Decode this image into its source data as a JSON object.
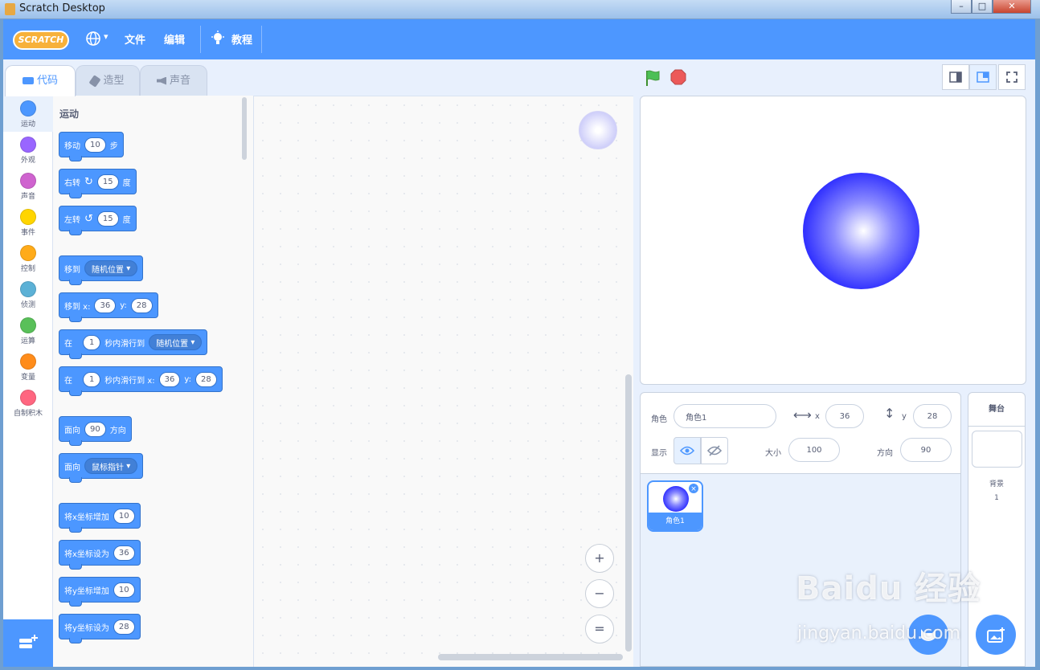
{
  "window": {
    "title": "Scratch Desktop",
    "controls": [
      "–",
      "□",
      "✕"
    ]
  },
  "menubar": {
    "logo": "SCRATCH",
    "language_caret": "▾",
    "file": "文件",
    "edit": "编辑",
    "tutorials": "教程"
  },
  "tabs": [
    "代码",
    "造型",
    "声音"
  ],
  "categories": [
    {
      "label": "运动",
      "color": "#4c97ff"
    },
    {
      "label": "外观",
      "color": "#9966ff"
    },
    {
      "label": "声音",
      "color": "#cf63cf"
    },
    {
      "label": "事件",
      "color": "#ffd500"
    },
    {
      "label": "控制",
      "color": "#ffab19"
    },
    {
      "label": "侦测",
      "color": "#5cb1d6"
    },
    {
      "label": "运算",
      "color": "#59c059"
    },
    {
      "label": "变量",
      "color": "#ff8c1a"
    },
    {
      "label": "自制积木",
      "color": "#ff6680"
    }
  ],
  "palette": {
    "section_title": "运动",
    "blocks": {
      "move": {
        "a": "移动",
        "v": "10",
        "b": "步"
      },
      "turn_right": {
        "a": "右转",
        "v": "15",
        "b": "度"
      },
      "turn_left": {
        "a": "左转",
        "v": "15",
        "b": "度"
      },
      "goto": {
        "a": "移到",
        "dd": "随机位置"
      },
      "goto_xy": {
        "a": "移到 x:",
        "x": "36",
        "yl": "y:",
        "y": "28"
      },
      "glide": {
        "a": "在",
        "v": "1",
        "b": "秒内滑行到",
        "dd": "随机位置"
      },
      "glide_xy": {
        "a": "在",
        "v": "1",
        "b": "秒内滑行到 x:",
        "x": "36",
        "yl": "y:",
        "y": "28"
      },
      "point_dir": {
        "a": "面向",
        "v": "90",
        "b": "方向"
      },
      "point_towards": {
        "a": "面向",
        "dd": "鼠标指针"
      },
      "change_x": {
        "a": "将x坐标增加",
        "v": "10"
      },
      "set_x": {
        "a": "将x坐标设为",
        "v": "36"
      },
      "change_y": {
        "a": "将y坐标增加",
        "v": "10"
      },
      "set_y": {
        "a": "将y坐标设为",
        "v": "28"
      }
    }
  },
  "zoom": {
    "in": "+",
    "out": "−",
    "reset": "="
  },
  "sprite_info": {
    "sprite_label": "角色",
    "sprite_name": "角色1",
    "x_label": "x",
    "x": "36",
    "y_label": "y",
    "y": "28",
    "show_label": "显示",
    "size_label": "大小",
    "size": "100",
    "direction_label": "方向",
    "direction": "90"
  },
  "sprites": [
    {
      "name": "角色1",
      "delete": "×"
    }
  ],
  "backdrop": {
    "header": "舞台",
    "label": "背景",
    "count": "1"
  },
  "watermark": {
    "main": "Baidu 经验",
    "sub": "jingyan.baidu.com"
  }
}
